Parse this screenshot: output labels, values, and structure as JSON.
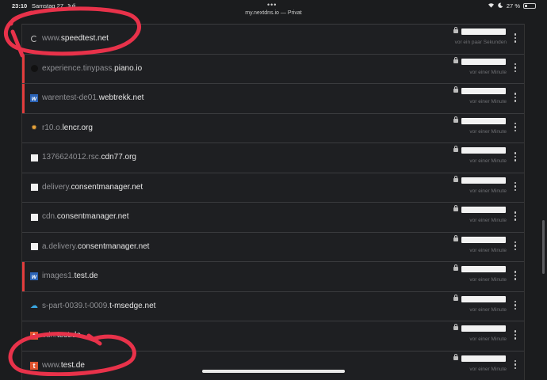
{
  "status_bar": {
    "time": "23:10",
    "date": "Samstag 27. Juli",
    "url": "my.nextdns.io — Privat",
    "dots": "•••",
    "battery": "27 %",
    "battery_level": 0.27
  },
  "colors": {
    "background": "#1b1c1e",
    "row_background": "#1e1f22",
    "blocked_accent": "#e23d3d",
    "annotation": "#e8324a"
  },
  "rows": [
    {
      "icon": "spinner-icon",
      "sub": "www.",
      "root": "speedtest.net",
      "time": "vor ein paar Sekunden",
      "blocked": false
    },
    {
      "icon": "dark-circle-icon",
      "sub": "experience.tinypass.",
      "root": "piano.io",
      "time": "vor einer Minute",
      "blocked": true
    },
    {
      "icon": "webtrekk-icon",
      "sub": "warentest-de01.",
      "root": "webtrekk.net",
      "time": "vor einer Minute",
      "blocked": true
    },
    {
      "icon": "sun-icon",
      "sub": "r10.o.",
      "root": "lencr.org",
      "time": "vor einer Minute",
      "blocked": false
    },
    {
      "icon": "white-square-icon",
      "sub": "1376624012.rsc.",
      "root": "cdn77.org",
      "time": "vor einer Minute",
      "blocked": false
    },
    {
      "icon": "white-square-icon",
      "sub": "delivery.",
      "root": "consentmanager.net",
      "time": "vor einer Minute",
      "blocked": false
    },
    {
      "icon": "white-square-icon",
      "sub": "cdn.",
      "root": "consentmanager.net",
      "time": "vor einer Minute",
      "blocked": false
    },
    {
      "icon": "white-square-icon",
      "sub": "a.delivery.",
      "root": "consentmanager.net",
      "time": "vor einer Minute",
      "blocked": false
    },
    {
      "icon": "webtrekk-icon",
      "sub": "images1.",
      "root": "test.de",
      "time": "vor einer Minute",
      "blocked": true
    },
    {
      "icon": "cloud-icon",
      "sub": "s-part-0039.t-0009.",
      "root": "t-msedge.net",
      "time": "vor einer Minute",
      "blocked": false
    },
    {
      "icon": "test-icon",
      "sub": "cdn.",
      "root": "test.de",
      "time": "vor einer Minute",
      "blocked": false
    },
    {
      "icon": "test-icon",
      "sub": "www.",
      "root": "test.de",
      "time": "vor einer Minute",
      "blocked": false
    }
  ]
}
